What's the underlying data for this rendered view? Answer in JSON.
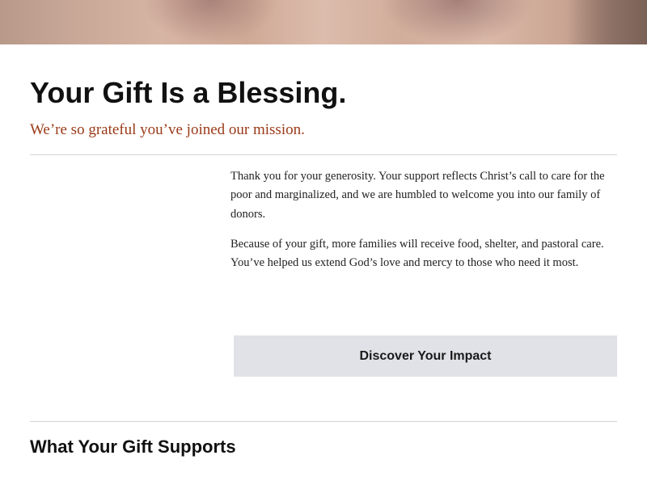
{
  "header": {
    "title": "Your Gift Is a Blessing.",
    "subtitle": "We’re so grateful you’ve joined our mission."
  },
  "body": {
    "paragraphs": [
      "Thank you for your generosity. Your support reflects Christ’s call to care for the poor and marginalized, and we are humbled to welcome you into our family of donors.",
      "Because of your gift, more families will receive food, shelter, and pastoral care. You’ve helped us extend God’s love and mercy to those who need it most."
    ]
  },
  "cta": {
    "label": "Discover Your Impact"
  },
  "next_section": {
    "title": "What Your Gift Supports"
  },
  "colors": {
    "subtitle": "#9a3a18",
    "button_bg": "#e1e2e7",
    "divider": "#d4d4d4"
  }
}
